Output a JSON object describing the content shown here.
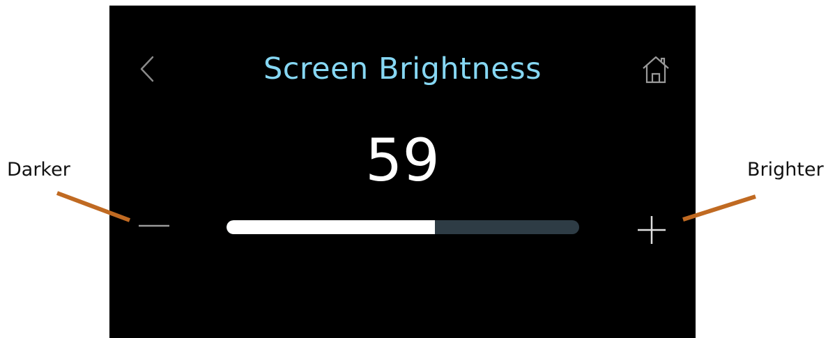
{
  "screen": {
    "title": "Screen Brightness",
    "back_icon": "chevron-left-icon",
    "home_icon": "home-icon"
  },
  "brightness": {
    "value": "59",
    "level": 0.59,
    "decrease_icon": "minus-icon",
    "increase_icon": "plus-icon"
  },
  "callouts": {
    "left_label": "Darker",
    "right_label": "Brighter"
  },
  "colors": {
    "title": "#86d7f3",
    "slider_track": "#2e3c45",
    "slider_fill": "#ffffff",
    "callout_line": "#c06a22",
    "screen_bg": "#000000"
  }
}
